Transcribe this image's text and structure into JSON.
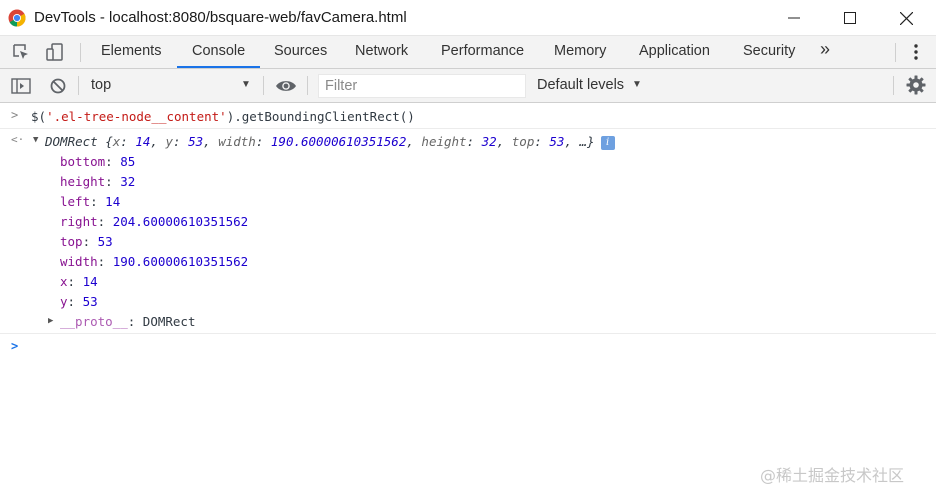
{
  "window": {
    "title": "DevTools - localhost:8080/bsquare-web/favCamera.html"
  },
  "tabs": [
    {
      "label": "Elements"
    },
    {
      "label": "Console"
    },
    {
      "label": "Sources"
    },
    {
      "label": "Network"
    },
    {
      "label": "Performance"
    },
    {
      "label": "Memory"
    },
    {
      "label": "Application"
    },
    {
      "label": "Security"
    }
  ],
  "active_tab": "Console",
  "more_tabs_label": "»",
  "console_toolbar": {
    "context": "top",
    "filter_placeholder": "Filter",
    "levels": "Default levels"
  },
  "console": {
    "command": {
      "prefix": "$(",
      "selector": "'.el-tree-node__content'",
      "suffix": ").getBoundingClientRect()"
    },
    "result": {
      "type": "DOMRect",
      "preview": [
        {
          "key": "x",
          "value": "14"
        },
        {
          "key": "y",
          "value": "53"
        },
        {
          "key": "width",
          "value": "190.60000610351562"
        },
        {
          "key": "height",
          "value": "32"
        },
        {
          "key": "top",
          "value": "53"
        }
      ],
      "ellipsis": "…}",
      "info_badge": "i",
      "properties": [
        {
          "key": "bottom",
          "value": "85"
        },
        {
          "key": "height",
          "value": "32"
        },
        {
          "key": "left",
          "value": "14"
        },
        {
          "key": "right",
          "value": "204.60000610351562"
        },
        {
          "key": "top",
          "value": "53"
        },
        {
          "key": "width",
          "value": "190.60000610351562"
        },
        {
          "key": "x",
          "value": "14"
        },
        {
          "key": "y",
          "value": "53"
        }
      ],
      "proto": {
        "key": "__proto__",
        "value": "DOMRect"
      }
    }
  },
  "watermark": "@稀土掘金技术社区",
  "colors": {
    "accent": "#1a73e8",
    "string": "#c41a16",
    "key": "#881391",
    "number": "#1c00cf"
  }
}
